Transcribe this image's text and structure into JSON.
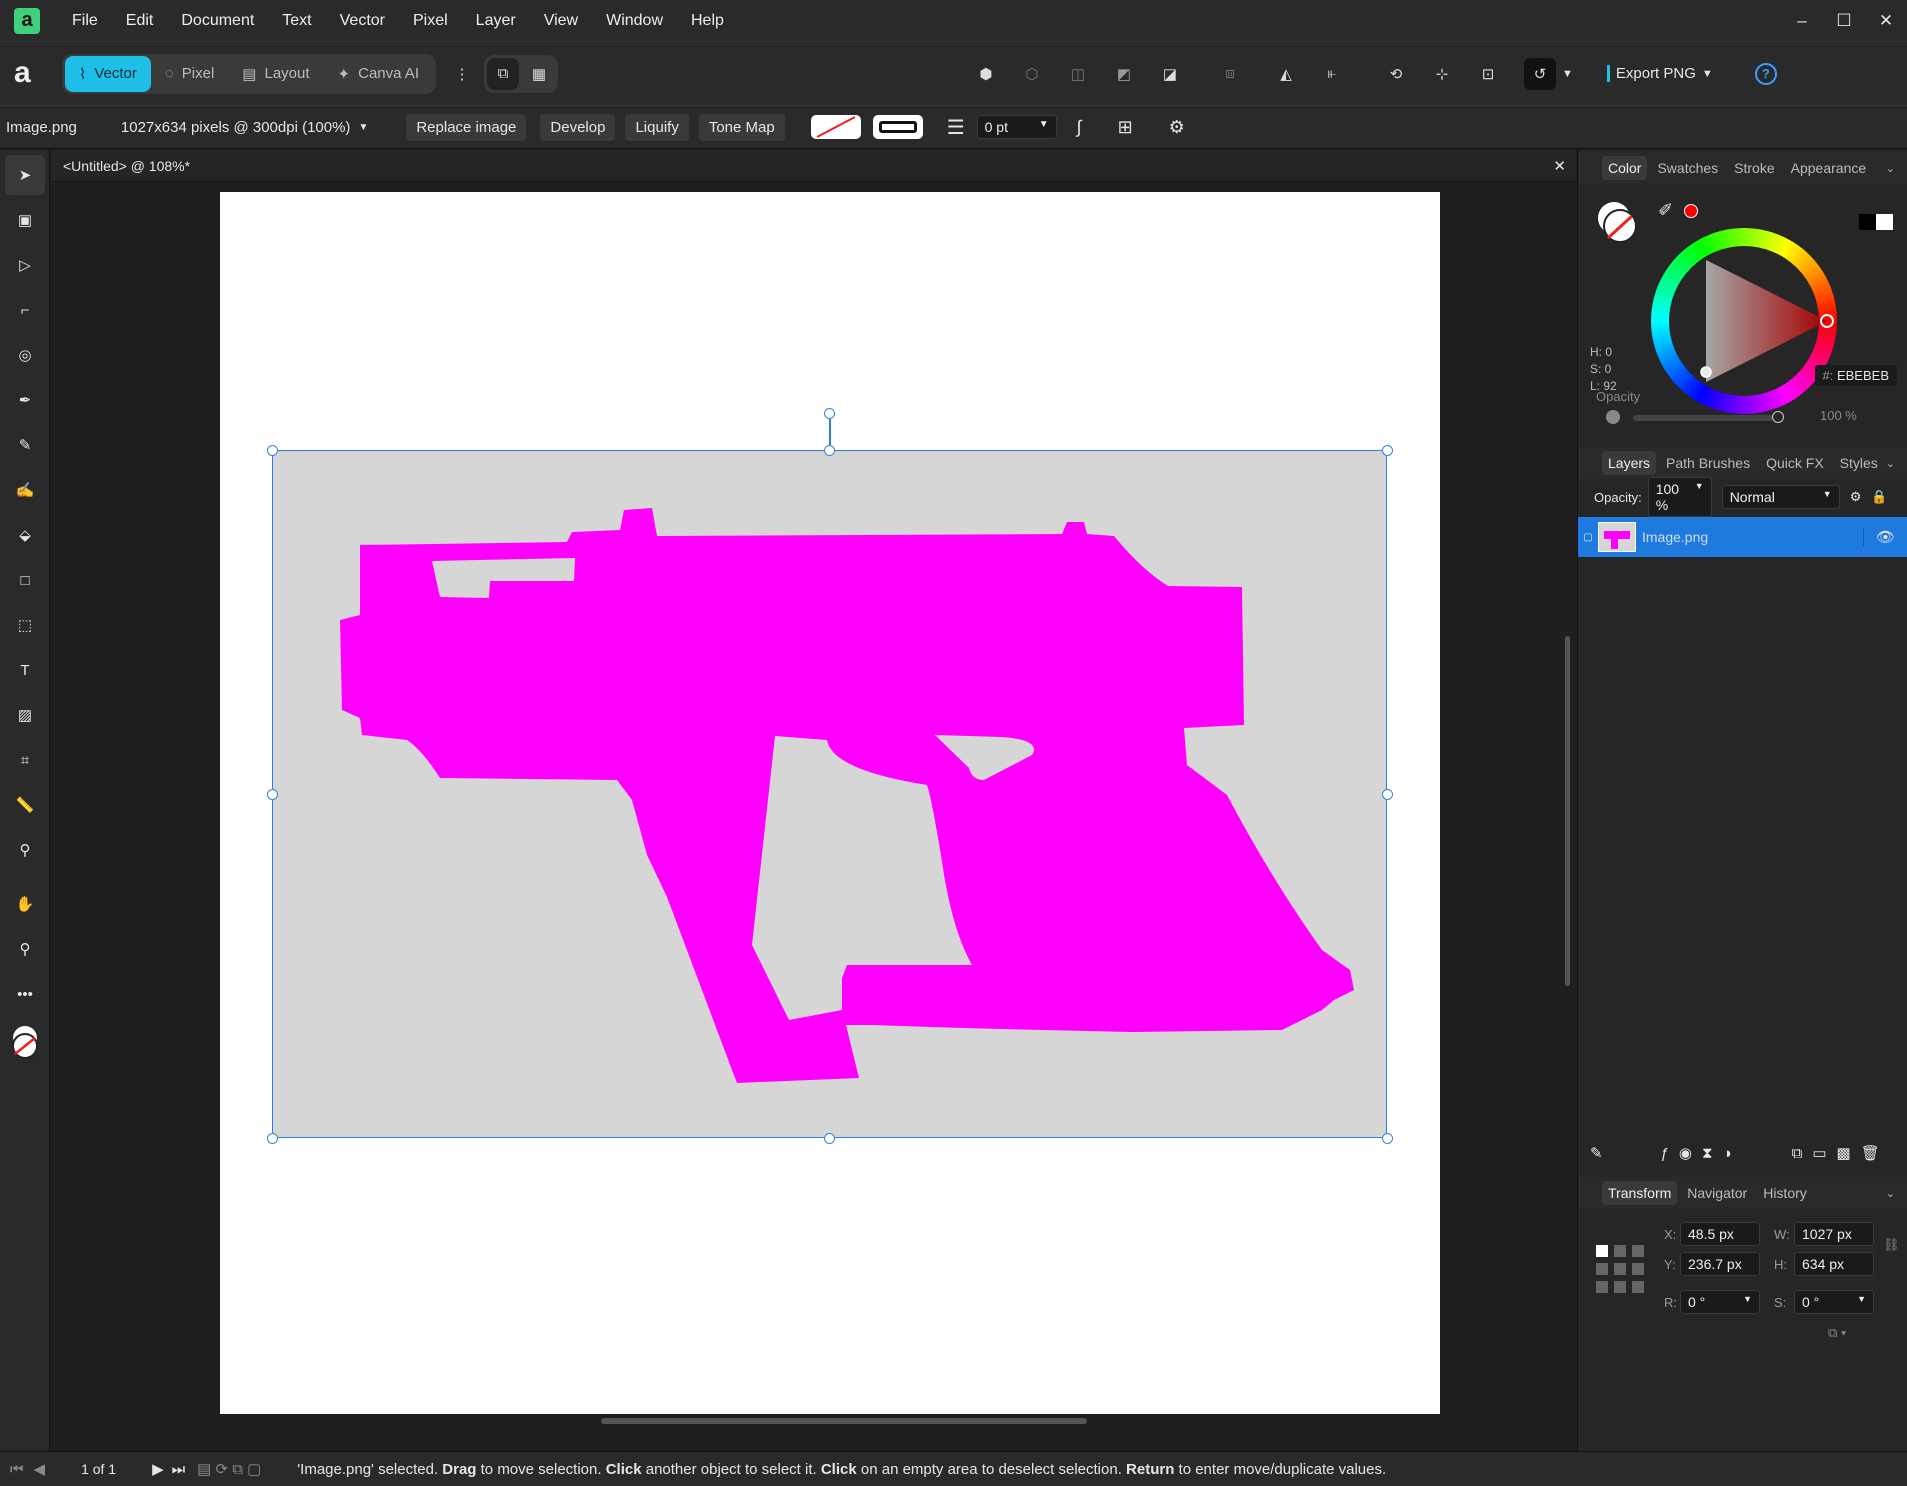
{
  "menu": [
    "File",
    "Edit",
    "Document",
    "Text",
    "Vector",
    "Pixel",
    "Layer",
    "View",
    "Window",
    "Help"
  ],
  "window_controls": [
    "–",
    "☐",
    "✕"
  ],
  "personas": [
    {
      "label": "Vector",
      "active": true
    },
    {
      "label": "Pixel",
      "active": false
    },
    {
      "label": "Layout",
      "active": false
    },
    {
      "label": "Canva AI",
      "active": false
    }
  ],
  "toolbar": {
    "export_label": "Export PNG",
    "help": "?"
  },
  "context": {
    "filename": "Image.png",
    "dimensions": "1027x634 pixels @ 300dpi (100%)",
    "replace": "Replace image",
    "develop": "Develop",
    "liquify": "Liquify",
    "tonemap": "Tone Map",
    "stroke_width": "0 pt"
  },
  "document_tab": "<Untitled> @ 108%*",
  "color_panel": {
    "tabs": [
      "Color",
      "Swatches",
      "Stroke",
      "Appearance"
    ],
    "h": "H: 0",
    "s": "S: 0",
    "l": "L: 92",
    "hex": "EBEBEB",
    "hex_prefix": "#:",
    "opacity_label": "Opacity",
    "opacity_value": "100 %"
  },
  "layers_panel": {
    "tabs": [
      "Layers",
      "Path Brushes",
      "Quick FX",
      "Styles"
    ],
    "opacity_label": "Opacity:",
    "opacity_value": "100 %",
    "blend": "Normal",
    "layer_name": "Image.png"
  },
  "transform_panel": {
    "tabs": [
      "Transform",
      "Navigator",
      "History"
    ],
    "x_label": "X:",
    "x": "48.5 px",
    "y_label": "Y:",
    "y": "236.7 px",
    "w_label": "W:",
    "w": "1027 px",
    "h_label": "H:",
    "h": "634 px",
    "r_label": "R:",
    "r": "0 °",
    "s_label": "S:",
    "s": "0 °"
  },
  "status": {
    "page": "1 of 1",
    "msg_1": "'Image.png' selected. ",
    "b1": "Drag",
    "msg_2": " to move selection. ",
    "b2": "Click",
    "msg_3": " another object to select it. ",
    "b3": "Click",
    "msg_4": " on an empty area to deselect selection. ",
    "b4": "Return",
    "msg_5": " to enter move/duplicate values."
  },
  "colors": {
    "accent": "#1ec0e8",
    "selection": "#2f7fe0",
    "shape": "#ff00ff",
    "image_bg": "#d6d6d6"
  }
}
